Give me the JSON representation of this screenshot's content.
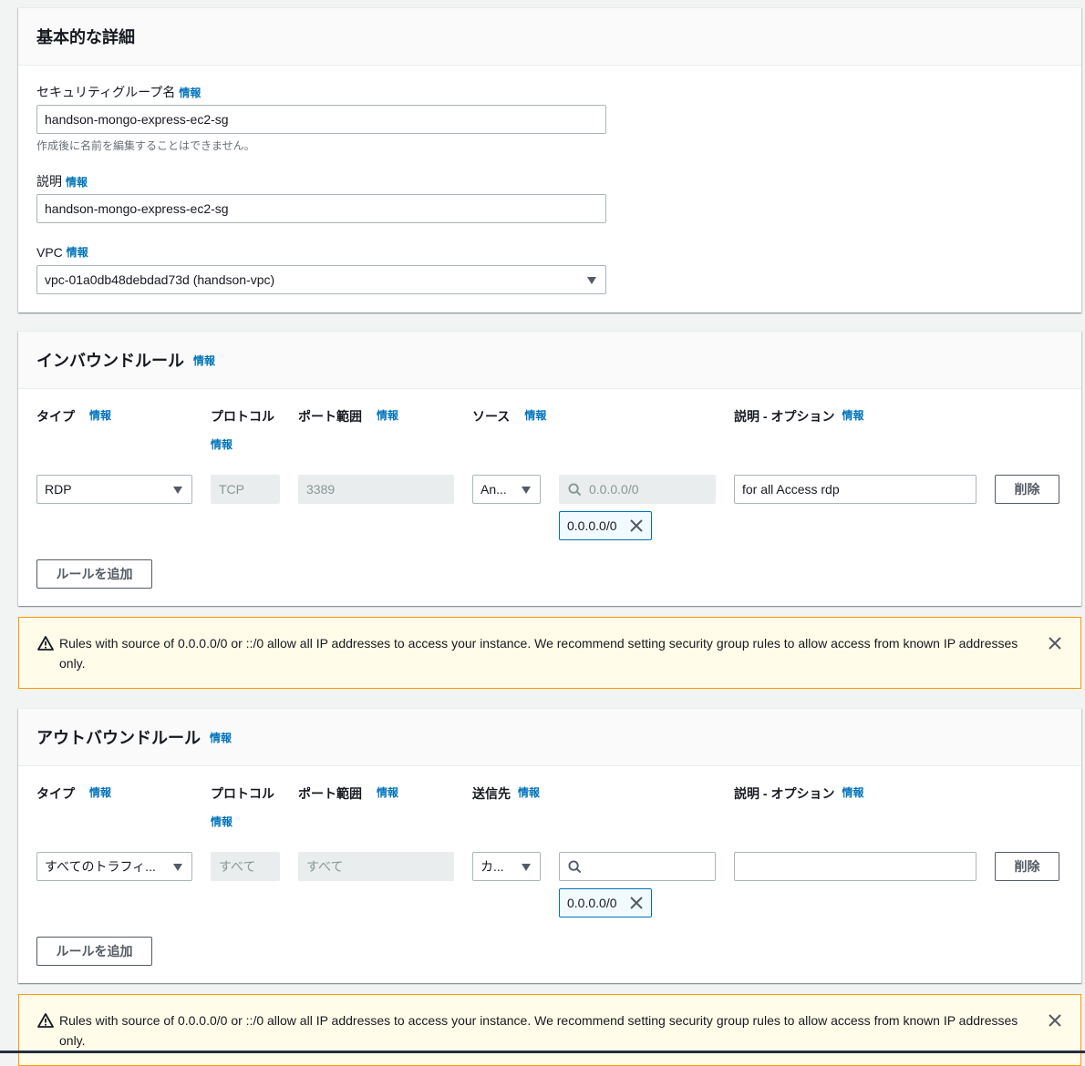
{
  "info_label": "情報",
  "basic": {
    "title": "基本的な詳細",
    "sg_name_label": "セキュリティグループ名",
    "sg_name_value": "handson-mongo-express-ec2-sg",
    "sg_name_hint": "作成後に名前を編集することはできません。",
    "desc_label": "説明",
    "desc_value": "handson-mongo-express-ec2-sg",
    "vpc_label": "VPC",
    "vpc_value": "vpc-01a0db48debdad73d (handson-vpc)"
  },
  "inbound": {
    "title": "インバウンドルール",
    "col_type": "タイプ",
    "col_protocol": "プロトコル",
    "col_port": "ポート範囲",
    "col_source": "ソース",
    "col_desc": "説明 - オプション",
    "row": {
      "type": "RDP",
      "protocol": "TCP",
      "port": "3389",
      "source_select": "An...",
      "cidr_placeholder": "0.0.0.0/0",
      "token": "0.0.0.0/0",
      "description": "for all Access rdp",
      "delete_label": "削除"
    },
    "add_rule_label": "ルールを追加"
  },
  "inbound_warning": "Rules with source of 0.0.0.0/0 or ::/0 allow all IP addresses to access your instance. We recommend setting security group rules to allow access from known IP addresses only.",
  "outbound": {
    "title": "アウトバウンドルール",
    "col_type": "タイプ",
    "col_protocol": "プロトコル",
    "col_port": "ポート範囲",
    "col_dest": "送信先",
    "col_desc": "説明 - オプション",
    "row": {
      "type": "すべてのトラフィ...",
      "protocol": "すべて",
      "port": "すべて",
      "dest_select": "カ...",
      "cidr_value": "",
      "token": "0.0.0.0/0",
      "description": "",
      "delete_label": "削除"
    },
    "add_rule_label": "ルールを追加"
  },
  "outbound_warning": "Rules with source of 0.0.0.0/0 or ::/0 allow all IP addresses to access your instance. We recommend setting security group rules to allow access from known IP addresses only.",
  "colors": {
    "info_link": "#0073bb",
    "warning_border": "#ff9900",
    "warning_bg": "#fffce9",
    "token_border": "#0073bb"
  }
}
